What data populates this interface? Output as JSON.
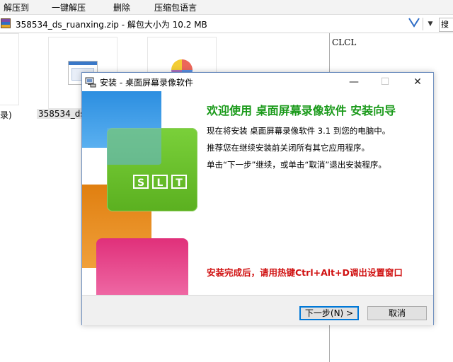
{
  "menubar": {
    "items": [
      "解压到",
      "一键解压",
      "删除",
      "压缩包语言"
    ]
  },
  "addressbar": {
    "path": "358534_ds_ruanxing.zip - 解包大小为 10.2 MB",
    "dropdown_glyph": "▼",
    "search_placeholder": "搜"
  },
  "files": {
    "items": [
      {
        "label": "录)"
      },
      {
        "label": "358534_ds"
      }
    ]
  },
  "right_pane": {
    "text": "CLCL"
  },
  "installer": {
    "title": "安装 - 桌面屏幕录像软件",
    "controls": {
      "minimize": "—",
      "maximize": "☐",
      "close": "✕"
    },
    "banner_text": [
      "S",
      "L",
      "T"
    ],
    "heading": "欢迎使用 桌面屏幕录像软件 安装向导",
    "lines": [
      "现在将安装 桌面屏幕录像软件 3.1 到您的电脑中。",
      "推荐您在继续安装前关闭所有其它应用程序。",
      "单击“下一步”继续，或单击“取消”退出安装程序。"
    ],
    "note": "安装完成后，请用热键Ctrl+Alt+D调出设置窗口",
    "buttons": {
      "next": "下一步(N) >",
      "cancel": "取消"
    }
  },
  "colors": {
    "heading": "#1a9a1a",
    "note": "#d01010",
    "accent": "#0078d7"
  }
}
